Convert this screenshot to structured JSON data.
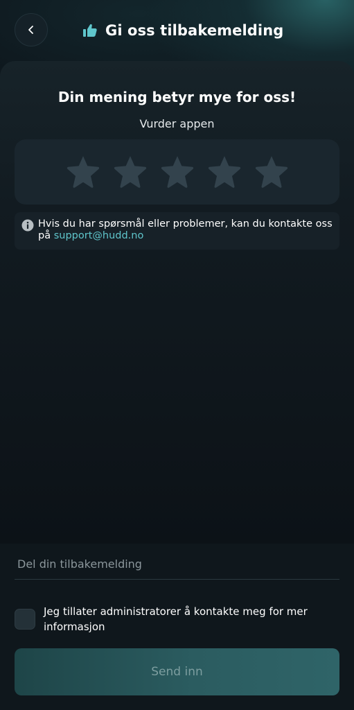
{
  "header": {
    "title": "Gi oss tilbakemelding",
    "back_icon": "chevron-left-icon",
    "title_icon": "thumbs-up-icon"
  },
  "content": {
    "heading": "Din mening betyr mye for oss!",
    "subheading": "Vurder appen",
    "rating": {
      "max": 5,
      "value": 0
    },
    "info": {
      "text": "Hvis du har spørsmål eller problemer, kan du kontakte oss på ",
      "email": "support@hudd.no",
      "icon": "info-icon"
    }
  },
  "form": {
    "feedback_placeholder": "Del din tilbakemelding",
    "feedback_value": "",
    "consent_label": "Jeg tillater administratorer å kontakte meg for mer informasjon",
    "consent_checked": false,
    "submit_label": "Send inn"
  },
  "colors": {
    "accent": "#5fc6cc",
    "background": "#0e171d",
    "star_empty": "#33434d",
    "submit_bg": "#2b5c60",
    "submit_text": "#7d9ea0"
  }
}
